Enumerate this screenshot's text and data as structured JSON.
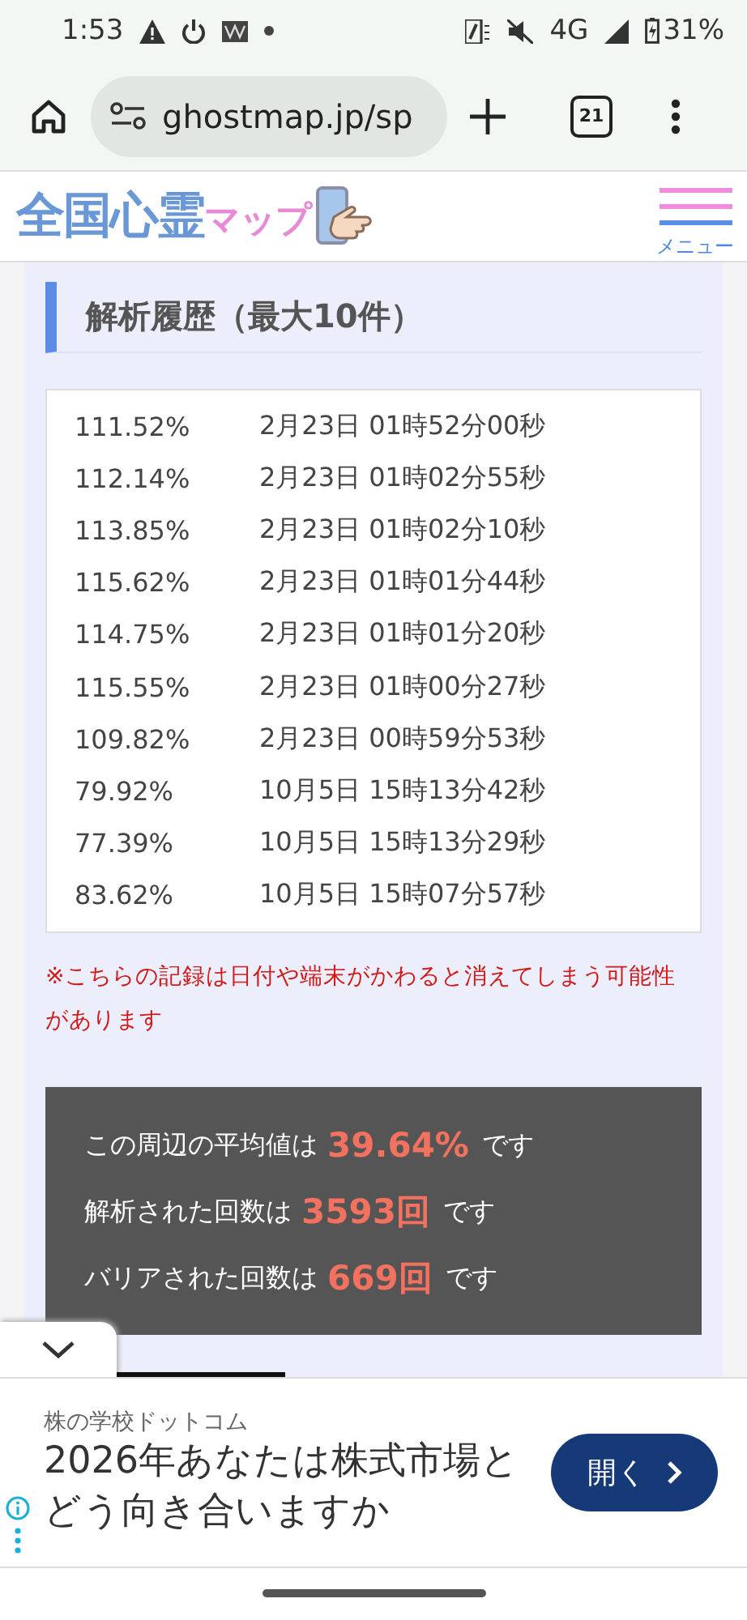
{
  "status_bar": {
    "time": "1:53",
    "network": "4G",
    "battery": "31%"
  },
  "browser": {
    "url": "ghostmap.jp/sp",
    "tab_count": "21"
  },
  "site_header": {
    "logo": "全国心霊マップ",
    "menu_label": "メニュー"
  },
  "history": {
    "title": "解析履歴（最大10件）",
    "rows": [
      {
        "value": "111.52%",
        "time": "2月23日 01時52分00秒"
      },
      {
        "value": "112.14%",
        "time": "2月23日 01時02分55秒"
      },
      {
        "value": "113.85%",
        "time": "2月23日 01時02分10秒"
      },
      {
        "value": "115.62%",
        "time": "2月23日 01時01分44秒"
      },
      {
        "value": "114.75%",
        "time": "2月23日 01時01分20秒"
      },
      {
        "value": "115.55%",
        "time": "2月23日 01時00分27秒"
      },
      {
        "value": "109.82%",
        "time": "2月23日 00時59分53秒"
      },
      {
        "value": "79.92%",
        "time": "10月5日 15時13分42秒"
      },
      {
        "value": "77.39%",
        "time": "10月5日 15時13分29秒"
      },
      {
        "value": "83.62%",
        "time": "10月5日 15時07分57秒"
      }
    ],
    "note": "※こちらの記録は日付や端末がかわると消えてしまう可能性があります"
  },
  "stats": [
    "この周辺の平均値は**39.64%**です",
    "解析された回数は**3593回**です",
    "バリアされた回数は**669回**です"
  ],
  "ad": {
    "advertiser": "株の学校ドットコム",
    "headline": "2026年あなたは株式市場とどう向き合いますか",
    "button": "開く"
  }
}
